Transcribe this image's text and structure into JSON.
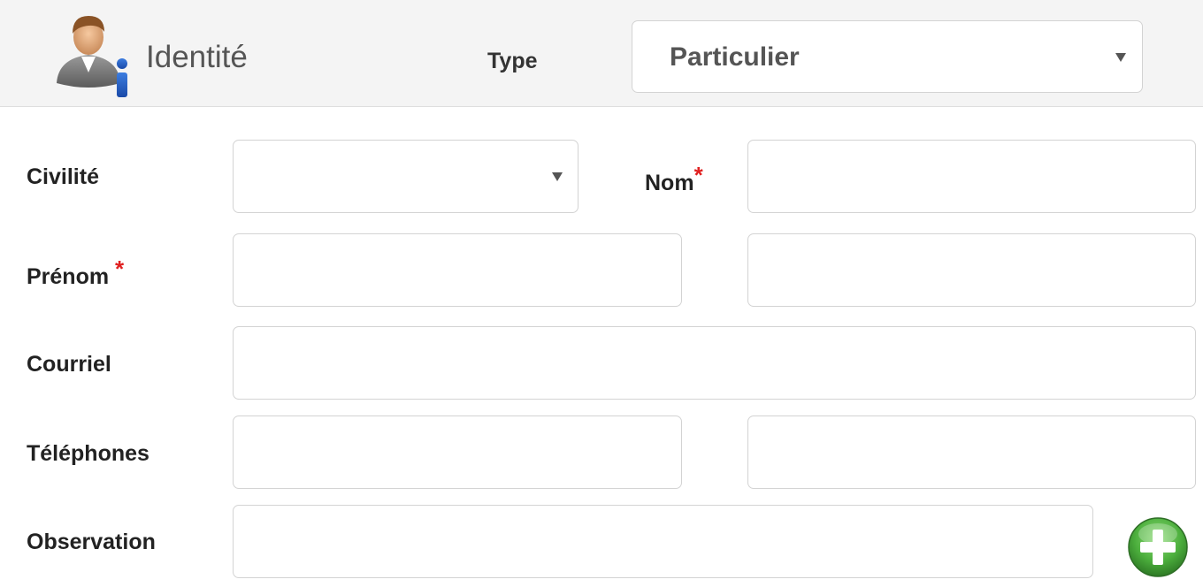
{
  "header": {
    "icon": "user-info-icon",
    "title": "Identité",
    "type_label": "Type",
    "type_value": "Particulier"
  },
  "form": {
    "civilite": {
      "label": "Civilité",
      "value": ""
    },
    "nom": {
      "label": "Nom",
      "required_mark": "*",
      "value": ""
    },
    "prenom": {
      "label": "Prénom",
      "required_mark": "*",
      "value": ""
    },
    "prenom_extra": {
      "value": ""
    },
    "courriel": {
      "label": "Courriel",
      "value": ""
    },
    "telephones": {
      "label": "Téléphones",
      "value_1": "",
      "value_2": ""
    },
    "observation": {
      "label": "Observation",
      "value": ""
    }
  },
  "buttons": {
    "add_icon": "plus-circle-icon"
  },
  "colors": {
    "header_bg": "#f4f4f4",
    "required": "#e02020",
    "add_button": "#4caf3d",
    "border": "#d3d3d3"
  }
}
